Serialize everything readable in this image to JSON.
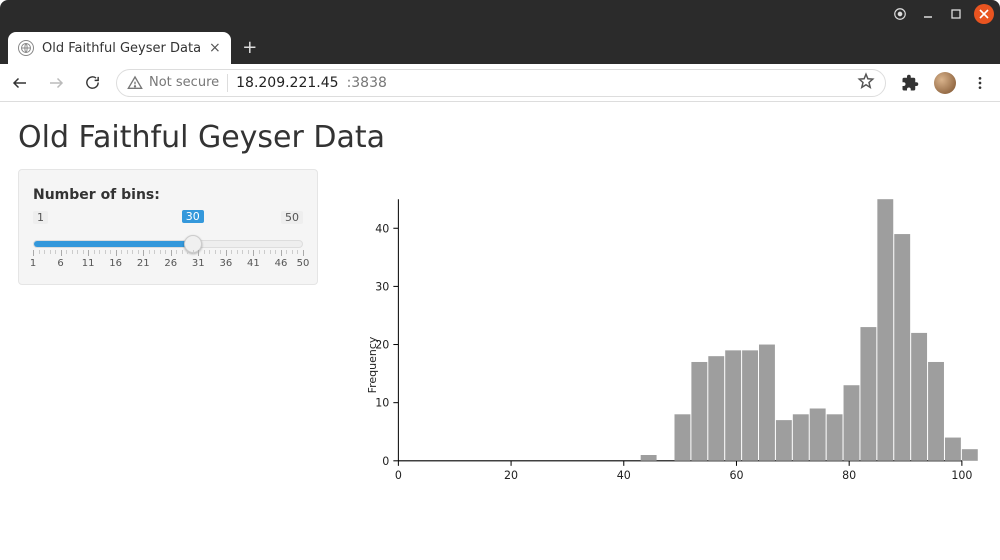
{
  "window": {
    "tab_title": "Old Faithful Geyser Data"
  },
  "toolbar": {
    "secure_label": "Not secure",
    "url_host": "18.209.221.45",
    "url_port": ":3838"
  },
  "page": {
    "title": "Old Faithful Geyser Data"
  },
  "slider": {
    "label": "Number of bins:",
    "min": 1,
    "max": 50,
    "value": 30,
    "ticks": [
      1,
      6,
      11,
      16,
      21,
      26,
      31,
      36,
      41,
      46,
      50
    ]
  },
  "chart_data": {
    "type": "bar",
    "title": "",
    "xlabel": "",
    "ylabel": "Frequency",
    "xlim": [
      0,
      100
    ],
    "ylim": [
      0,
      45
    ],
    "x_ticks": [
      0,
      20,
      40,
      60,
      80,
      100
    ],
    "y_ticks": [
      0,
      10,
      20,
      30,
      40
    ],
    "bin_width": 3.0,
    "bin_start": 43,
    "values": [
      1,
      0,
      8,
      17,
      18,
      19,
      19,
      20,
      7,
      8,
      9,
      8,
      13,
      23,
      45,
      39,
      22,
      17,
      4,
      2
    ]
  }
}
